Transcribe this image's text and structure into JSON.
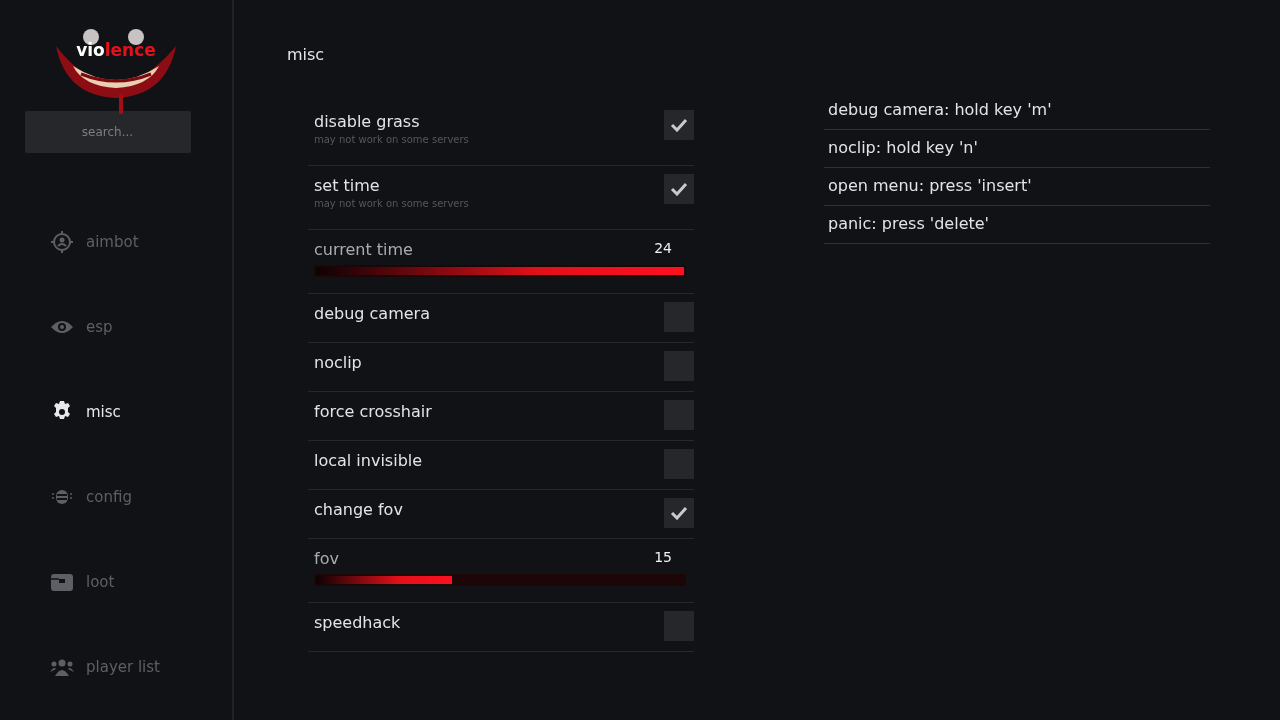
{
  "logo": {
    "parts": [
      {
        "text": "vio",
        "color": "#ffffff"
      },
      {
        "text": "lence",
        "color": "#e3111b"
      }
    ]
  },
  "search": {
    "placeholder": "search..."
  },
  "sidebar": {
    "items": [
      {
        "label": "aimbot",
        "kind": "crosshair",
        "selected": false
      },
      {
        "label": "esp",
        "kind": "eye",
        "selected": false
      },
      {
        "label": "misc",
        "kind": "gear",
        "selected": true
      },
      {
        "label": "config",
        "kind": "config",
        "selected": false
      },
      {
        "label": "loot",
        "kind": "chest",
        "selected": false
      },
      {
        "label": "player list",
        "kind": "players",
        "selected": false
      }
    ]
  },
  "page_title": "misc",
  "settings": [
    {
      "kind": "checkbox",
      "label": "disable grass",
      "note": "may not work on some servers",
      "checked": true
    },
    {
      "kind": "checkbox",
      "label": "set time",
      "note": "may not work on some servers",
      "checked": true
    },
    {
      "kind": "slider",
      "label": "current time",
      "reading": "24",
      "level": 1.0
    },
    {
      "kind": "checkbox",
      "label": "debug camera",
      "checked": false
    },
    {
      "kind": "checkbox",
      "label": "noclip",
      "checked": false
    },
    {
      "kind": "checkbox",
      "label": "force crosshair",
      "checked": false
    },
    {
      "kind": "checkbox",
      "label": "local invisible",
      "checked": false
    },
    {
      "kind": "checkbox",
      "label": "change fov",
      "checked": true
    },
    {
      "kind": "slider",
      "label": "fov",
      "reading": "15",
      "level": 0.37
    },
    {
      "kind": "checkbox",
      "label": "speedhack",
      "checked": false
    }
  ],
  "keybinds": [
    "debug camera: hold key 'm'",
    "noclip: hold key 'n'",
    "open menu: press 'insert'",
    "panic: press 'delete'"
  ]
}
